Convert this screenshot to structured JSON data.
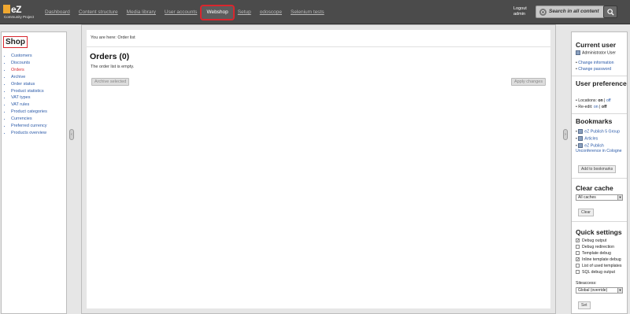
{
  "logo": {
    "name": "eZ",
    "tagline": "Community Project"
  },
  "tabs": [
    "Dashboard",
    "Content structure",
    "Media library",
    "User accounts",
    "Webshop",
    "Setup",
    "odoscope",
    "Selenium tests"
  ],
  "active_tab": "Webshop",
  "user": {
    "logout": "Logout",
    "name": "admin"
  },
  "search": {
    "placeholder": "Search in all content"
  },
  "left": {
    "title": "Shop",
    "items": [
      "Customers",
      "Discounts",
      "Orders",
      "Archive",
      "Order status",
      "Product statistics",
      "VAT types",
      "VAT rules",
      "Product categories",
      "Currencies",
      "Preferred currency",
      "Products overview"
    ],
    "current": "Orders"
  },
  "main": {
    "breadcrumb": "You are here:  Order list",
    "title": "Orders (0)",
    "empty": "The order list is empty.",
    "archive_button": "Archive selected",
    "apply_button": "Apply changes"
  },
  "right": {
    "current_user": {
      "title": "Current user",
      "name": "Administrator User",
      "links": [
        "Change information",
        "Change password"
      ]
    },
    "prefs": {
      "title": "User preferences",
      "locations_label": "Locations:",
      "locations_on": "on",
      "locations_off": "off",
      "reedit_label": "Re-edit:",
      "reedit_on": "on",
      "reedit_off": "off"
    },
    "bookmarks": {
      "title": "Bookmarks",
      "items": [
        "eZ Publish 5 Group",
        "Articles",
        "eZ Publish Unconference in Cologne"
      ],
      "add_button": "Add to bookmarks"
    },
    "cache": {
      "title": "Clear cache",
      "select": "All caches",
      "button": "Clear"
    },
    "quick": {
      "title": "Quick settings",
      "items": [
        {
          "label": "Debug output",
          "checked": true
        },
        {
          "label": "Debug redirection",
          "checked": false
        },
        {
          "label": "Template debug",
          "checked": false
        },
        {
          "label": "Inline template debug",
          "checked": true
        },
        {
          "label": "List of used templates",
          "checked": false
        },
        {
          "label": "SQL debug output",
          "checked": false
        }
      ],
      "siteaccess_label": "Siteaccess:",
      "siteaccess_value": "Global (override)",
      "set_button": "Set"
    }
  },
  "colors": {
    "accent": "#d9262e",
    "link": "#2b5aa8",
    "topbar": "#4b4b4b"
  }
}
